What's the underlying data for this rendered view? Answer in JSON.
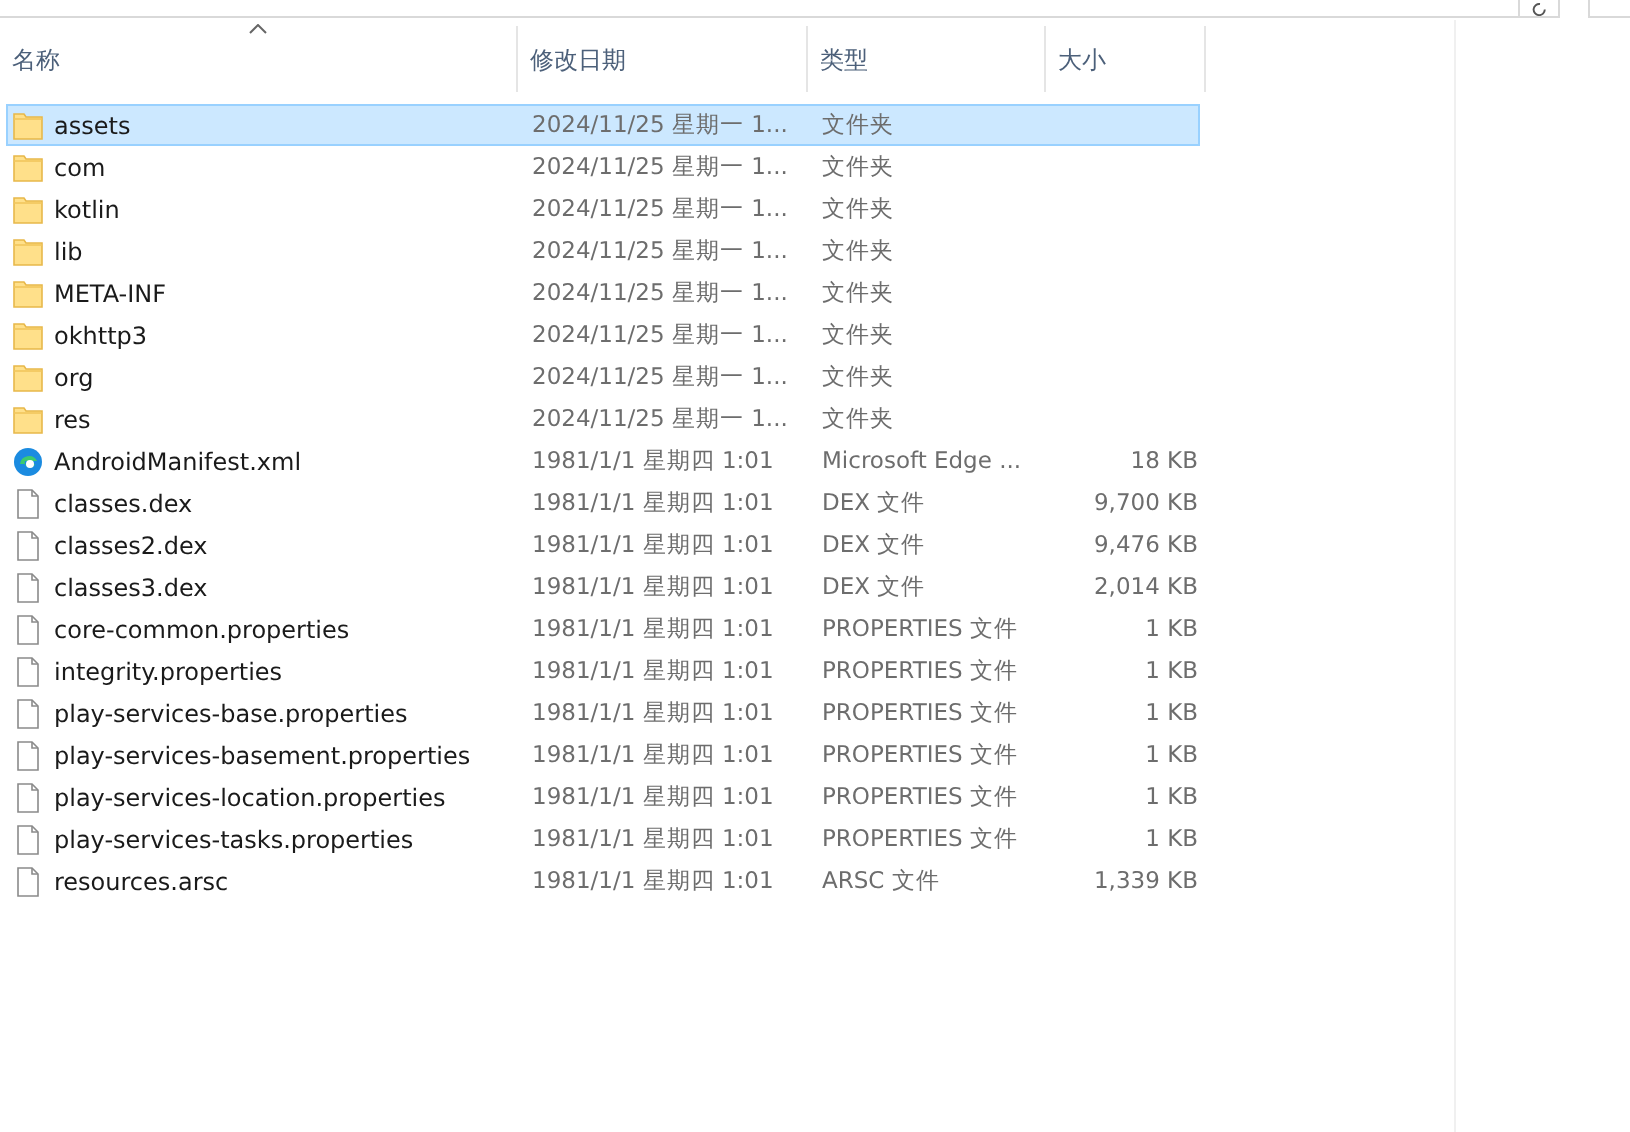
{
  "columns": [
    {
      "label": "名称",
      "sorted": true
    },
    {
      "label": "修改日期",
      "sorted": false
    },
    {
      "label": "类型",
      "sorted": false
    },
    {
      "label": "大小",
      "sorted": false
    }
  ],
  "rows": [
    {
      "kind": "folder",
      "name": "assets",
      "date": "2024/11/25 星期一 1...",
      "type": "文件夹",
      "selected": true
    },
    {
      "kind": "folder",
      "name": "com",
      "date": "2024/11/25 星期一 1...",
      "type": "文件夹",
      "selected": false
    },
    {
      "kind": "folder",
      "name": "kotlin",
      "date": "2024/11/25 星期一 1...",
      "type": "文件夹",
      "selected": false
    },
    {
      "kind": "folder",
      "name": "lib",
      "date": "2024/11/25 星期一 1...",
      "type": "文件夹",
      "selected": false
    },
    {
      "kind": "folder",
      "name": "META-INF",
      "date": "2024/11/25 星期一 1...",
      "type": "文件夹",
      "selected": false
    },
    {
      "kind": "folder",
      "name": "okhttp3",
      "date": "2024/11/25 星期一 1...",
      "type": "文件夹",
      "selected": false
    },
    {
      "kind": "folder",
      "name": "org",
      "date": "2024/11/25 星期一 1...",
      "type": "文件夹",
      "selected": false
    },
    {
      "kind": "folder",
      "name": "res",
      "date": "2024/11/25 星期一 1...",
      "type": "文件夹",
      "selected": false
    },
    {
      "kind": "edge",
      "name": "AndroidManifest.xml",
      "date": "1981/1/1 星期四 1:01",
      "type": "Microsoft Edge ...",
      "size": "18 KB",
      "selected": false
    },
    {
      "kind": "file",
      "name": "classes.dex",
      "date": "1981/1/1 星期四 1:01",
      "type": "DEX 文件",
      "size": "9,700 KB",
      "selected": false
    },
    {
      "kind": "file",
      "name": "classes2.dex",
      "date": "1981/1/1 星期四 1:01",
      "type": "DEX 文件",
      "size": "9,476 KB",
      "selected": false
    },
    {
      "kind": "file",
      "name": "classes3.dex",
      "date": "1981/1/1 星期四 1:01",
      "type": "DEX 文件",
      "size": "2,014 KB",
      "selected": false
    },
    {
      "kind": "file",
      "name": "core-common.properties",
      "date": "1981/1/1 星期四 1:01",
      "type": "PROPERTIES 文件",
      "size": "1 KB",
      "selected": false
    },
    {
      "kind": "file",
      "name": "integrity.properties",
      "date": "1981/1/1 星期四 1:01",
      "type": "PROPERTIES 文件",
      "size": "1 KB",
      "selected": false
    },
    {
      "kind": "file",
      "name": "play-services-base.properties",
      "date": "1981/1/1 星期四 1:01",
      "type": "PROPERTIES 文件",
      "size": "1 KB",
      "selected": false
    },
    {
      "kind": "file",
      "name": "play-services-basement.properties",
      "date": "1981/1/1 星期四 1:01",
      "type": "PROPERTIES 文件",
      "size": "1 KB",
      "selected": false
    },
    {
      "kind": "file",
      "name": "play-services-location.properties",
      "date": "1981/1/1 星期四 1:01",
      "type": "PROPERTIES 文件",
      "size": "1 KB",
      "selected": false
    },
    {
      "kind": "file",
      "name": "play-services-tasks.properties",
      "date": "1981/1/1 星期四 1:01",
      "type": "PROPERTIES 文件",
      "size": "1 KB",
      "selected": false
    },
    {
      "kind": "file",
      "name": "resources.arsc",
      "date": "1981/1/1 星期四 1:01",
      "type": "ARSC 文件",
      "size": "1,339 KB",
      "selected": false
    }
  ]
}
